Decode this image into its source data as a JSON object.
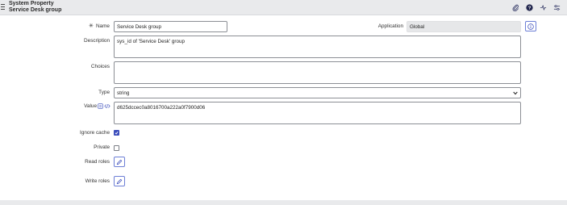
{
  "header": {
    "title_line1": "System Property",
    "title_line2": "Service Desk group",
    "icons": [
      "paperclip-icon",
      "help-icon",
      "activity-icon",
      "settings-sliders-icon"
    ]
  },
  "form": {
    "required_marker": "✳",
    "name": {
      "label": "Name",
      "value": "Service Desk group"
    },
    "application": {
      "label": "Application",
      "value": "Global"
    },
    "description": {
      "label": "Description",
      "value": "sys_id of 'Service Desk' group"
    },
    "choices": {
      "label": "Choices",
      "value": ""
    },
    "type": {
      "label": "Type",
      "value": "string"
    },
    "value": {
      "label": "Value",
      "value": "d625dccec0a8016700a222a0f7900d06"
    },
    "ignore_cache": {
      "label": "Ignore cache",
      "checked": true
    },
    "private": {
      "label": "Private",
      "checked": false
    },
    "read_roles": {
      "label": "Read roles"
    },
    "write_roles": {
      "label": "Write roles"
    }
  },
  "colors": {
    "accent": "#3b4dbb",
    "header_bg": "#e9eaec",
    "readonly_bg": "#e6e7e9"
  }
}
